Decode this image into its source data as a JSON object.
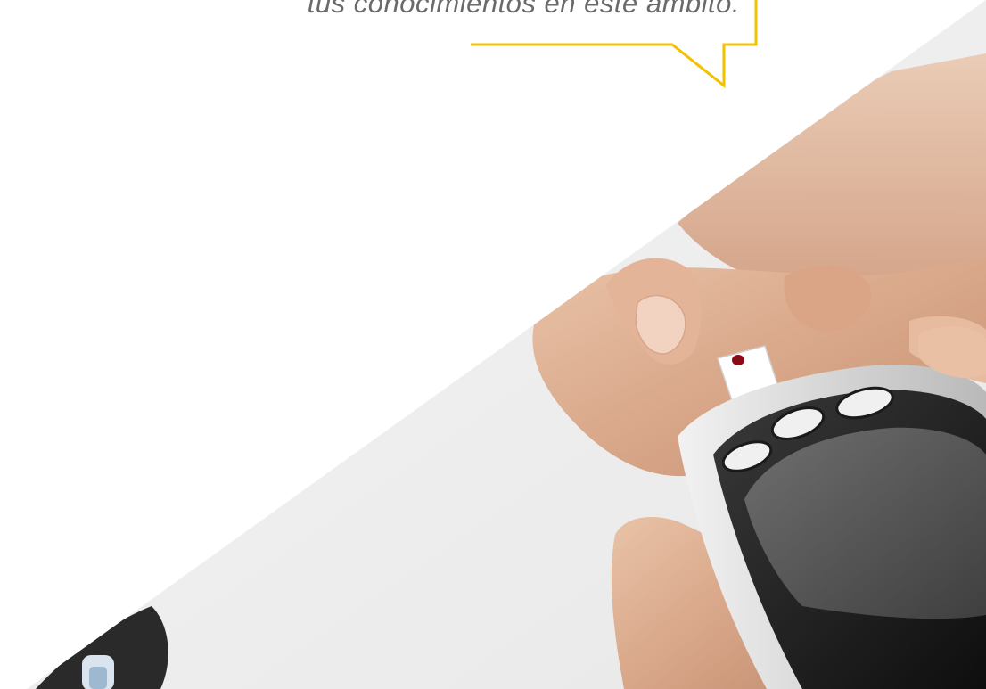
{
  "quote": {
    "text": "tus conocimientos en este ámbito."
  },
  "colors": {
    "accent": "#f2c200",
    "quote_text": "#6a6a6a",
    "background": "#ffffff"
  },
  "photo": {
    "subject": "glucometer-photo"
  }
}
